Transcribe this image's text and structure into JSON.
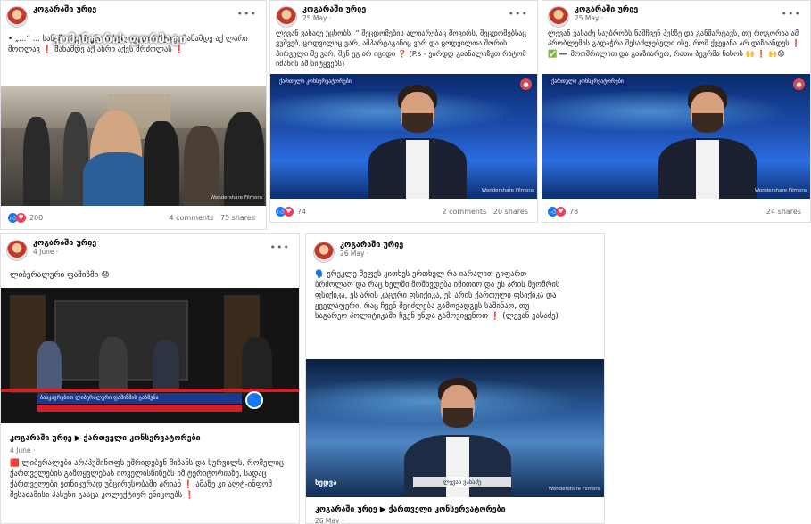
{
  "posts": [
    {
      "author": "კოგარაში ური̧ე",
      "date": "",
      "overlay": "კომენტარის ფორმატი",
      "text": "• „...“ ... სანამ ... ეპლვნის ცხელი გუჟი ანტ-ის, მანამდე აქ ლარი მოოლავ  ❗ მანამდე აქ ახრი აქვს მრძოლას ❗",
      "likes": "200",
      "comments": "4 comments",
      "shares": "75 shares",
      "icons": [
        "like-icon",
        "heart-icon"
      ]
    },
    {
      "author": "კოგარაში ური̧ე",
      "date": "25 May ·",
      "text": "ლევან ვასაძე უცხობს: “ შეცდომების ალიარებაც მოვირს, შეცდომებსაც ვუშვებ, ცოდვილიც ვარ, აშპარტაგანიც ვარ და ცოდვილთა შორის პირველი მე ვარ, შენ ეგ არ იციდი ❓ (P.s - ეარდდ გაანალიზეთ რატომ იძახის ამ სიტყვებს)",
      "banner": "ქართული კონსერვატორები",
      "watermark": "Wondershare Filmora",
      "likes": "74",
      "comments": "2 comments",
      "shares": "20 shares"
    },
    {
      "author": "კოგარაში ური̧ე",
      "date": "25 May ·",
      "text": "ლევან ვასაძე საუბრობს ნაშჩვენ პუსზე და განმარტავს, თუ როგორაა ამ პრობლემის გადაჭრა შესაძლებელი ისე, რომ ქვეყანა არ დაზიანდეს ❗ ✅ ➖ მოოშრილით და გააზიარეთ, რათა ბევრმა ნახოს 🙌 ❗ 🙌😟",
      "banner": "ქართული კონსერვატორები",
      "watermark": "Wondershare Filmora",
      "likes": "78",
      "comments": "",
      "shares": "24 shares"
    },
    {
      "author": "კოგარაში ური̧ე",
      "date": "4 June ·",
      "text": "ლიბერალური ფაშიზმი 😟",
      "ticker": "ბასკავრებით ლიბერალური ფაშიზმის გაბმვნა",
      "link_title": "კოგარაში ური̧ე ▶ ქართველი კონსერვატორები",
      "link_date": "4 June ·",
      "link_text": "🟥 ლიბერალები არაპუშინოფს უშრიდებენ მიზანს და სურვილს, რომელიც ქართველების გამოყვლებას იოველისწინებს იმ ტერიტორიაზე, სადაც ქართველები ეთნიკურად უმცირესობაში არიან ❗ ამაზე კი ალტ-ინფომ შესაძამისი პასუხი გასცა კოლექტიურ ენიკოებს ❗"
    },
    {
      "author": "კოგარაში ური̧ე",
      "date": "26 May ·",
      "text": "🗣️ ერეკლე მეფეს კითხეს ერთხელ რა იარაღით გიფართ ბრძოლაო და რაც ხელში მოშხვდება იმითიო და ეს არის მეომრის ფსიქიკა, ეს არის კაცური ფსიქიკა, ეს არის ქართული ფსიქიკა და ყველაფერი, რაც ჩვენ შეიძლება გამოვადგეს საშინაო, თუ საგარეო პოლიტიკაში ჩვენ უნდა გამოვიყენოთ ❗ (ლევან ვასაძე)",
      "lower_third": "ლევან ვასაძე",
      "lower_label": "ხედვა",
      "watermark": "Wondershare Filmora",
      "link_title": "კოგარაში ური̧ე ▶ ქართველი კონსერვატორები",
      "link_date": "26 May ·"
    }
  ],
  "colors": {
    "like": "#1877f2",
    "heart": "#f33e58",
    "studio_blue": "#1d4fb0",
    "ticker_red": "#d0202a"
  }
}
